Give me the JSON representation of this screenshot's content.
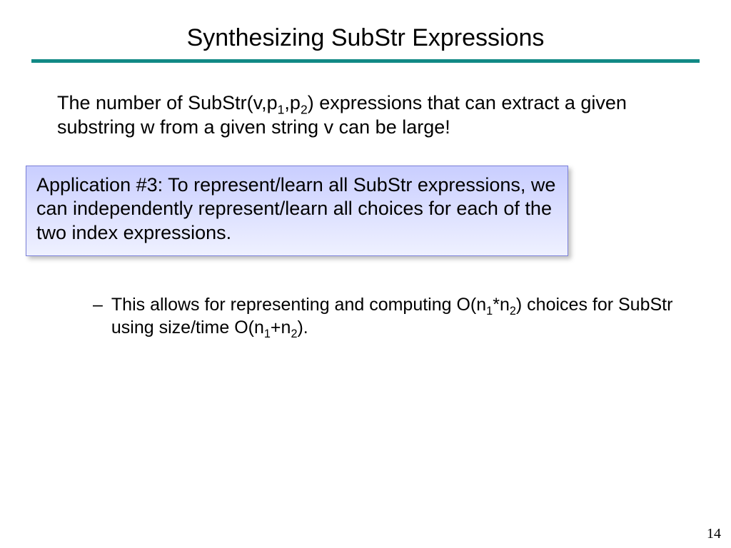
{
  "title": "Synthesizing SubStr Expressions",
  "paragraph": {
    "pre": "The number of SubStr(v,p",
    "s1": "1",
    "mid1": ",p",
    "s2": "2",
    "post": ") expressions that can extract a given substring w from a given string v can be large!"
  },
  "callout": "Application #3: To represent/learn all SubStr expressions, we can independently represent/learn all choices for each of the two index expressions.",
  "bullet": {
    "dash": "–",
    "t1": "This allows for representing and computing O(n",
    "s1": "1",
    "t2": "*n",
    "s2": "2",
    "t3": ") choices for SubStr using size/time O(n",
    "s3": "1",
    "t4": "+n",
    "s4": "2",
    "t5": ")."
  },
  "page": "14"
}
